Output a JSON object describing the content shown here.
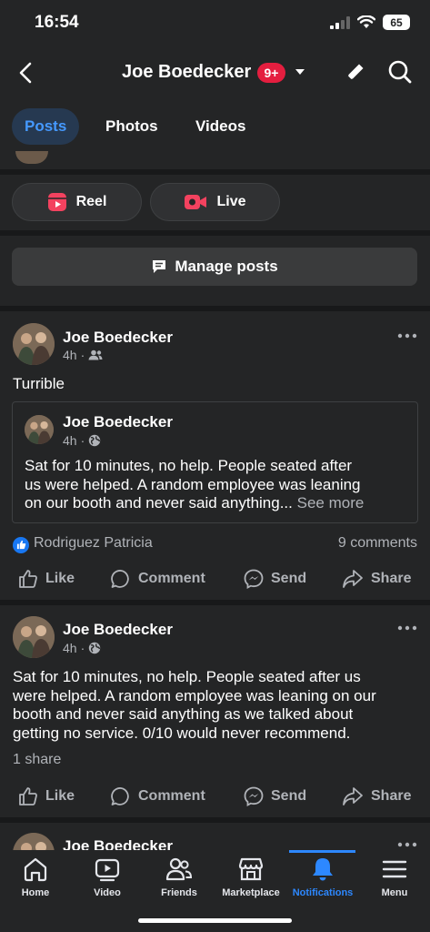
{
  "status": {
    "time": "16:54",
    "battery": "65"
  },
  "header": {
    "title": "Joe Boedecker",
    "badge": "9+"
  },
  "tabs": [
    {
      "label": "Posts"
    },
    {
      "label": "Photos"
    },
    {
      "label": "Videos"
    }
  ],
  "create": {
    "reel_label": "Reel",
    "live_label": "Live"
  },
  "manage_posts_label": "Manage posts",
  "posts": [
    {
      "author": "Joe Boedecker",
      "time": "4h",
      "text": "Turrible",
      "shared": {
        "author": "Joe Boedecker",
        "time": "4h",
        "lines": [
          "Sat for 10 minutes, no help. People seated after",
          "us were helped. A random employee was leaning",
          "on our booth and never said anything..."
        ],
        "see_more": "See more"
      },
      "reactor": "Rodriguez Patricia",
      "comments": "9 comments"
    },
    {
      "author": "Joe Boedecker",
      "time": "4h",
      "lines": [
        "Sat for 10 minutes, no help. People seated after us",
        "were helped. A random employee was leaning on our",
        "booth and never said anything as we talked about",
        "getting no service. 0/10 would never recommend."
      ],
      "shares": "1 share"
    },
    {
      "author": "Joe Boedecker"
    }
  ],
  "actions": {
    "like": "Like",
    "comment": "Comment",
    "send": "Send",
    "share": "Share"
  },
  "nav": [
    {
      "label": "Home",
      "icon": "home-icon"
    },
    {
      "label": "Video",
      "icon": "video-icon"
    },
    {
      "label": "Friends",
      "icon": "friends-icon"
    },
    {
      "label": "Marketplace",
      "icon": "marketplace-icon"
    },
    {
      "label": "Notifications",
      "icon": "bell-icon"
    },
    {
      "label": "Menu",
      "icon": "menu-icon"
    }
  ],
  "colors": {
    "background": "#242526",
    "separator": "#18191a",
    "accent": "#2d88ff",
    "badge": "#e41e3f",
    "active_tab_bg": "#263951"
  }
}
